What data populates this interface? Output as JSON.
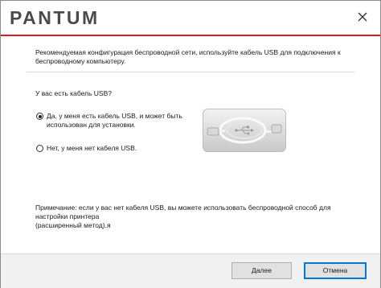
{
  "header": {
    "logo_text": "PANTUM",
    "accent_color": "#d51e1e"
  },
  "content": {
    "intro": "Рекомендуемая конфигурация беспроводной сети, используйте кабель USB для подключения к беспроводному компьютеру.",
    "question": "У вас есть кабель USB?",
    "options": [
      {
        "label_line1": "Да, у меня есть кабель USB, и может быть",
        "label_line2": "использован для установки.",
        "selected": true
      },
      {
        "label_line1": "Нет, у меня нет кабеля USB.",
        "label_line2": "",
        "selected": false
      }
    ],
    "note_line1": "Примечание: если у вас нет кабеля USB, вы можете использовать беспроводной способ для настройки принтера",
    "note_line2": "(расширенный метод).я"
  },
  "footer": {
    "next_label": "Далее",
    "cancel_label": "Отмена"
  },
  "icons": {
    "close": "close-icon",
    "usb": "usb-cable-icon"
  }
}
